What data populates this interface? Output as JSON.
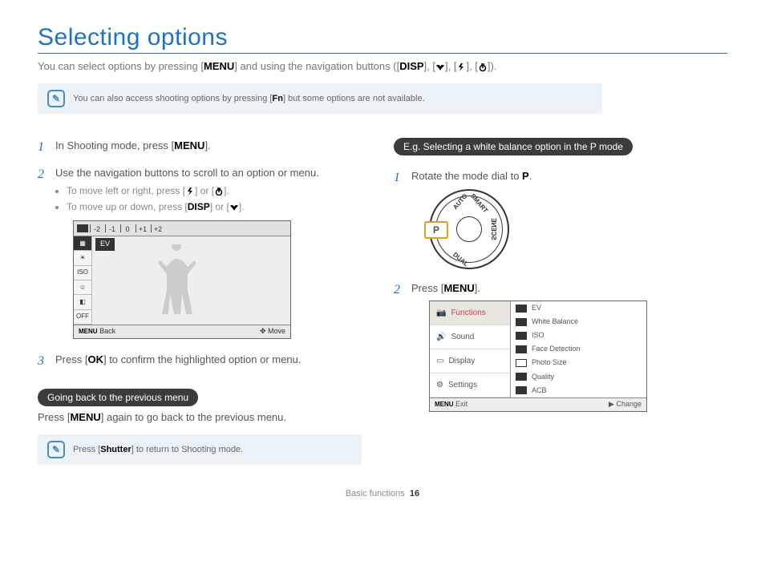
{
  "title": "Selecting options",
  "intro": {
    "prefix": "You can select options by pressing [",
    "menu": "MENU",
    "mid": "] and using the navigation buttons ([",
    "b1": "DISP",
    "sep": "], [",
    "suffix": "])."
  },
  "note1": {
    "pre": "You can also access shooting options by pressing [",
    "fn": "Fn",
    "post": "] but some options are not available."
  },
  "left": {
    "step1_pre": "In Shooting mode, press [",
    "step1_b": "MENU",
    "step1_post": "].",
    "step2": "Use the navigation buttons to scroll to an option or menu.",
    "s2a_pre": "To move left or right, press [",
    "s2a_mid": "] or [",
    "s2a_post": "].",
    "s2b_pre": "To move up or down, press [",
    "s2b_b": "DISP",
    "s2b_mid": "] or [",
    "s2b_post": "].",
    "ev": "EV",
    "back": "Back",
    "move": "Move",
    "ticks": [
      "-2",
      "-1",
      "0",
      "+1",
      "+2"
    ],
    "step3_pre": "Press [",
    "step3_b": "OK",
    "step3_post": "] to confirm the highlighted option or menu.",
    "pill": "Going back to the previous menu",
    "back_text_pre": "Press [",
    "back_text_b": "MENU",
    "back_text_post": "] again to go back to the previous menu.",
    "note2_pre": "Press [",
    "note2_b": "Shutter",
    "note2_post": "] to return to Shooting mode."
  },
  "right": {
    "pill": "E.g. Selecting a white balance option in the P mode",
    "step1_pre": "Rotate the mode dial to ",
    "step1_b": "P",
    "step1_post": ".",
    "dial_p": "P",
    "dial_labels": {
      "auto": "AUTO",
      "smart": "SMART",
      "scene": "SCENE",
      "dual": "DUAL"
    },
    "step2_pre": "Press [",
    "step2_b": "MENU",
    "step2_post": "].",
    "menu_left": [
      "Functions",
      "Sound",
      "Display",
      "Settings"
    ],
    "menu_right": [
      "EV",
      "White Balance",
      "ISO",
      "Face Detection",
      "Photo Size",
      "Quality",
      "ACB"
    ],
    "exit": "Exit",
    "change": "Change"
  },
  "footer": {
    "section": "Basic functions",
    "page": "16"
  }
}
